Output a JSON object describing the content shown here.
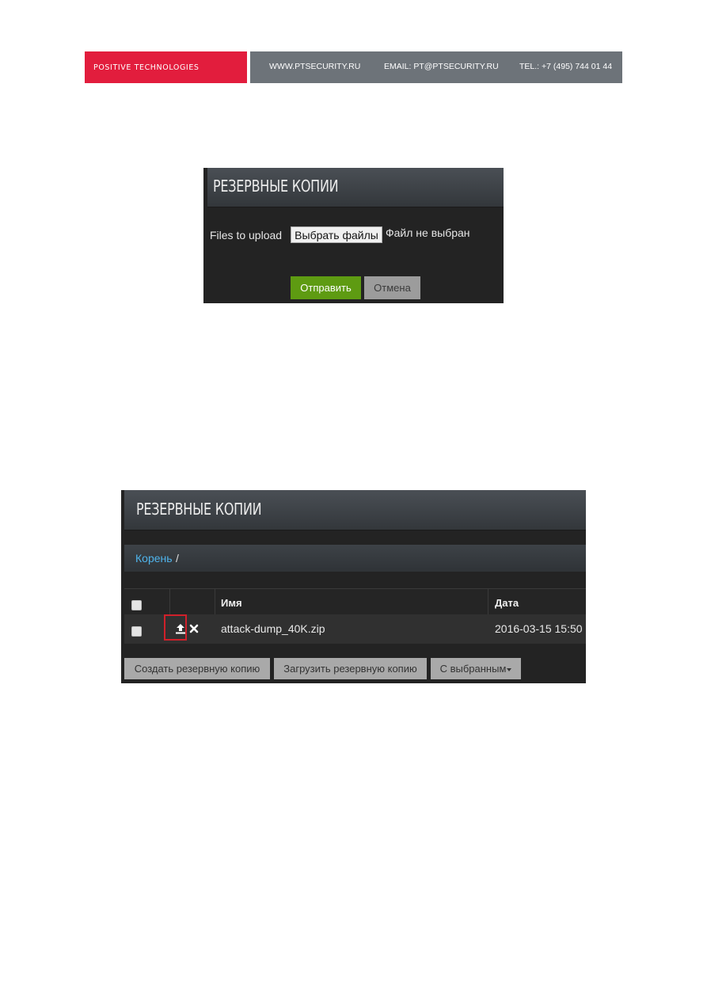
{
  "banner": {
    "company": "POSITIVE TECHNOLOGIES",
    "website": "WWW.PTSECURITY.RU",
    "email": "EMAIL: PT@PTSECURITY.RU",
    "phone": "TEL.: +7 (495) 744 01 44",
    "colors": {
      "brand_red": "#e21d3d",
      "info_gray": "#6d7379"
    }
  },
  "upload_dialog": {
    "title": "РЕЗЕРВНЫЕ КОПИИ",
    "files_label": "Files to upload",
    "choose_files_button": "Выбрать файлы",
    "file_status": "Файл не выбран",
    "submit_button": "Отправить",
    "cancel_button": "Отмена",
    "colors": {
      "submit_green": "#5e9b12"
    }
  },
  "backups_list": {
    "title": "РЕЗЕРВНЫЕ КОПИИ",
    "breadcrumb": {
      "root": "Корень",
      "separator": "/"
    },
    "columns": [
      "Имя",
      "Дата"
    ],
    "rows": [
      {
        "name": "attack-dump_40K.zip",
        "date": "2016-03-15 15:50",
        "checked": false,
        "actions": [
          "upload-icon",
          "close-icon"
        ]
      }
    ],
    "buttons": {
      "create": "Создать резервную копию",
      "upload": "Загрузить резервную копию",
      "with_selected": "С выбранным"
    },
    "colors": {
      "link_blue": "#4fb4ec",
      "highlight_red": "#d0202a"
    }
  }
}
